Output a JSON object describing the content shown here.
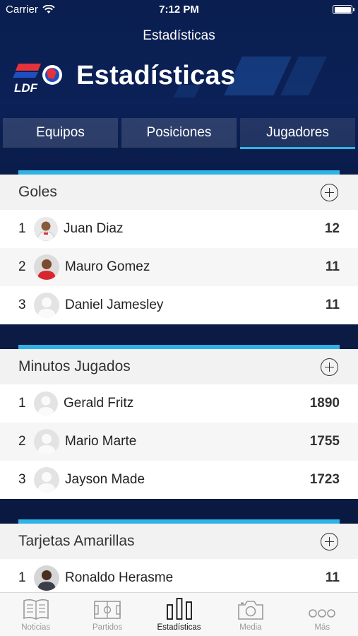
{
  "status": {
    "carrier": "Carrier",
    "time": "7:12 PM"
  },
  "nav": {
    "title": "Estadísticas"
  },
  "brand": {
    "logo_text": "LDF",
    "big_title": "Estadísticas"
  },
  "segments": [
    {
      "label": "Equipos",
      "active": false
    },
    {
      "label": "Posiciones",
      "active": false
    },
    {
      "label": "Jugadores",
      "active": true
    }
  ],
  "sections": [
    {
      "title": "Goles",
      "rows": [
        {
          "rank": "1",
          "name": "Juan Diaz",
          "value": "12",
          "avatar": "photo-white-kit"
        },
        {
          "rank": "2",
          "name": "Mauro Gomez",
          "value": "11",
          "avatar": "photo-red-kit"
        },
        {
          "rank": "3",
          "name": "Daniel Jamesley",
          "value": "11",
          "avatar": "placeholder"
        }
      ]
    },
    {
      "title": "Minutos Jugados",
      "rows": [
        {
          "rank": "1",
          "name": "Gerald Fritz",
          "value": "1890",
          "avatar": "placeholder"
        },
        {
          "rank": "2",
          "name": "Mario Marte",
          "value": "1755",
          "avatar": "placeholder"
        },
        {
          "rank": "3",
          "name": "Jayson Made",
          "value": "1723",
          "avatar": "placeholder"
        }
      ]
    },
    {
      "title": "Tarjetas Amarillas",
      "rows": [
        {
          "rank": "1",
          "name": "Ronaldo Herasme",
          "value": "11",
          "avatar": "photo-dark"
        }
      ]
    }
  ],
  "tabbar": [
    {
      "label": "Noticias",
      "icon": "newspaper-icon",
      "active": false
    },
    {
      "label": "Partidos",
      "icon": "field-icon",
      "active": false
    },
    {
      "label": "Estadísticas",
      "icon": "bars-icon",
      "active": true
    },
    {
      "label": "Media",
      "icon": "camera-icon",
      "active": false
    },
    {
      "label": "Más",
      "icon": "more-icon",
      "active": false
    }
  ],
  "colors": {
    "accent": "#2fb3e6",
    "navy": "#0a1e4f",
    "brand_red": "#e5323b",
    "brand_blue": "#1f4fbf"
  }
}
